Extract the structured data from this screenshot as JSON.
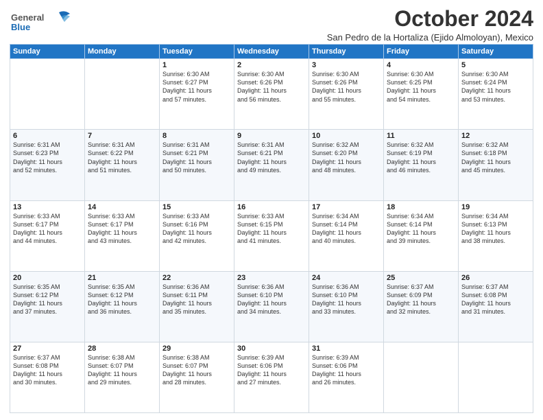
{
  "header": {
    "logo": {
      "line1": "General",
      "line2": "Blue"
    },
    "title": "October 2024",
    "subtitle": "San Pedro de la Hortaliza (Ejido Almoloyan), Mexico"
  },
  "weekdays": [
    "Sunday",
    "Monday",
    "Tuesday",
    "Wednesday",
    "Thursday",
    "Friday",
    "Saturday"
  ],
  "weeks": [
    [
      {
        "day": "",
        "info": ""
      },
      {
        "day": "",
        "info": ""
      },
      {
        "day": "1",
        "info": "Sunrise: 6:30 AM\nSunset: 6:27 PM\nDaylight: 11 hours\nand 57 minutes."
      },
      {
        "day": "2",
        "info": "Sunrise: 6:30 AM\nSunset: 6:26 PM\nDaylight: 11 hours\nand 56 minutes."
      },
      {
        "day": "3",
        "info": "Sunrise: 6:30 AM\nSunset: 6:26 PM\nDaylight: 11 hours\nand 55 minutes."
      },
      {
        "day": "4",
        "info": "Sunrise: 6:30 AM\nSunset: 6:25 PM\nDaylight: 11 hours\nand 54 minutes."
      },
      {
        "day": "5",
        "info": "Sunrise: 6:30 AM\nSunset: 6:24 PM\nDaylight: 11 hours\nand 53 minutes."
      }
    ],
    [
      {
        "day": "6",
        "info": "Sunrise: 6:31 AM\nSunset: 6:23 PM\nDaylight: 11 hours\nand 52 minutes."
      },
      {
        "day": "7",
        "info": "Sunrise: 6:31 AM\nSunset: 6:22 PM\nDaylight: 11 hours\nand 51 minutes."
      },
      {
        "day": "8",
        "info": "Sunrise: 6:31 AM\nSunset: 6:21 PM\nDaylight: 11 hours\nand 50 minutes."
      },
      {
        "day": "9",
        "info": "Sunrise: 6:31 AM\nSunset: 6:21 PM\nDaylight: 11 hours\nand 49 minutes."
      },
      {
        "day": "10",
        "info": "Sunrise: 6:32 AM\nSunset: 6:20 PM\nDaylight: 11 hours\nand 48 minutes."
      },
      {
        "day": "11",
        "info": "Sunrise: 6:32 AM\nSunset: 6:19 PM\nDaylight: 11 hours\nand 46 minutes."
      },
      {
        "day": "12",
        "info": "Sunrise: 6:32 AM\nSunset: 6:18 PM\nDaylight: 11 hours\nand 45 minutes."
      }
    ],
    [
      {
        "day": "13",
        "info": "Sunrise: 6:33 AM\nSunset: 6:17 PM\nDaylight: 11 hours\nand 44 minutes."
      },
      {
        "day": "14",
        "info": "Sunrise: 6:33 AM\nSunset: 6:17 PM\nDaylight: 11 hours\nand 43 minutes."
      },
      {
        "day": "15",
        "info": "Sunrise: 6:33 AM\nSunset: 6:16 PM\nDaylight: 11 hours\nand 42 minutes."
      },
      {
        "day": "16",
        "info": "Sunrise: 6:33 AM\nSunset: 6:15 PM\nDaylight: 11 hours\nand 41 minutes."
      },
      {
        "day": "17",
        "info": "Sunrise: 6:34 AM\nSunset: 6:14 PM\nDaylight: 11 hours\nand 40 minutes."
      },
      {
        "day": "18",
        "info": "Sunrise: 6:34 AM\nSunset: 6:14 PM\nDaylight: 11 hours\nand 39 minutes."
      },
      {
        "day": "19",
        "info": "Sunrise: 6:34 AM\nSunset: 6:13 PM\nDaylight: 11 hours\nand 38 minutes."
      }
    ],
    [
      {
        "day": "20",
        "info": "Sunrise: 6:35 AM\nSunset: 6:12 PM\nDaylight: 11 hours\nand 37 minutes."
      },
      {
        "day": "21",
        "info": "Sunrise: 6:35 AM\nSunset: 6:12 PM\nDaylight: 11 hours\nand 36 minutes."
      },
      {
        "day": "22",
        "info": "Sunrise: 6:36 AM\nSunset: 6:11 PM\nDaylight: 11 hours\nand 35 minutes."
      },
      {
        "day": "23",
        "info": "Sunrise: 6:36 AM\nSunset: 6:10 PM\nDaylight: 11 hours\nand 34 minutes."
      },
      {
        "day": "24",
        "info": "Sunrise: 6:36 AM\nSunset: 6:10 PM\nDaylight: 11 hours\nand 33 minutes."
      },
      {
        "day": "25",
        "info": "Sunrise: 6:37 AM\nSunset: 6:09 PM\nDaylight: 11 hours\nand 32 minutes."
      },
      {
        "day": "26",
        "info": "Sunrise: 6:37 AM\nSunset: 6:08 PM\nDaylight: 11 hours\nand 31 minutes."
      }
    ],
    [
      {
        "day": "27",
        "info": "Sunrise: 6:37 AM\nSunset: 6:08 PM\nDaylight: 11 hours\nand 30 minutes."
      },
      {
        "day": "28",
        "info": "Sunrise: 6:38 AM\nSunset: 6:07 PM\nDaylight: 11 hours\nand 29 minutes."
      },
      {
        "day": "29",
        "info": "Sunrise: 6:38 AM\nSunset: 6:07 PM\nDaylight: 11 hours\nand 28 minutes."
      },
      {
        "day": "30",
        "info": "Sunrise: 6:39 AM\nSunset: 6:06 PM\nDaylight: 11 hours\nand 27 minutes."
      },
      {
        "day": "31",
        "info": "Sunrise: 6:39 AM\nSunset: 6:06 PM\nDaylight: 11 hours\nand 26 minutes."
      },
      {
        "day": "",
        "info": ""
      },
      {
        "day": "",
        "info": ""
      }
    ]
  ]
}
